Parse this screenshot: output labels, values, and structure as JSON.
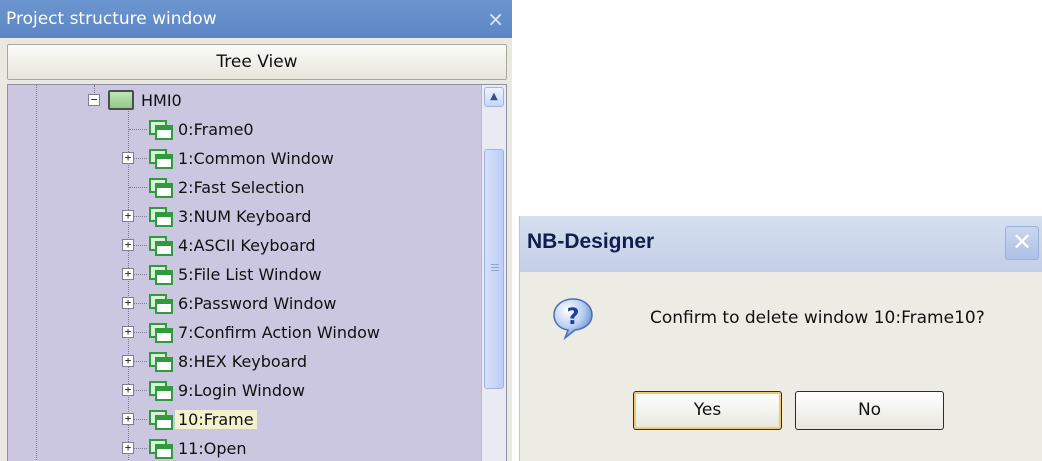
{
  "project_window": {
    "title": "Project structure window",
    "close_glyph": "×",
    "tab_label": "Tree View",
    "root": {
      "label": "HMI0",
      "expander": "−"
    },
    "items": [
      {
        "label": "0:Frame0",
        "expander": ""
      },
      {
        "label": "1:Common Window",
        "expander": "+"
      },
      {
        "label": "2:Fast Selection",
        "expander": ""
      },
      {
        "label": "3:NUM Keyboard",
        "expander": "+"
      },
      {
        "label": "4:ASCII Keyboard",
        "expander": "+"
      },
      {
        "label": "5:File List Window",
        "expander": "+"
      },
      {
        "label": "6:Password Window",
        "expander": "+"
      },
      {
        "label": "7:Confirm Action Window",
        "expander": "+"
      },
      {
        "label": "8:HEX Keyboard",
        "expander": "+"
      },
      {
        "label": "9:Login Window",
        "expander": "+"
      },
      {
        "label": "10:Frame",
        "expander": "+"
      },
      {
        "label": "11:Open",
        "expander": "+"
      }
    ],
    "scroll_up_glyph": "▲"
  },
  "dialog": {
    "title": "NB-Designer",
    "close_glyph": "✕",
    "message": "Confirm to delete window 10:Frame10?",
    "yes_label": "Yes",
    "no_label": "No"
  },
  "colors": {
    "title_bar": "#5b86c4",
    "tree_background": "#cbc7e1",
    "window_icon": "#2f9a3e"
  }
}
